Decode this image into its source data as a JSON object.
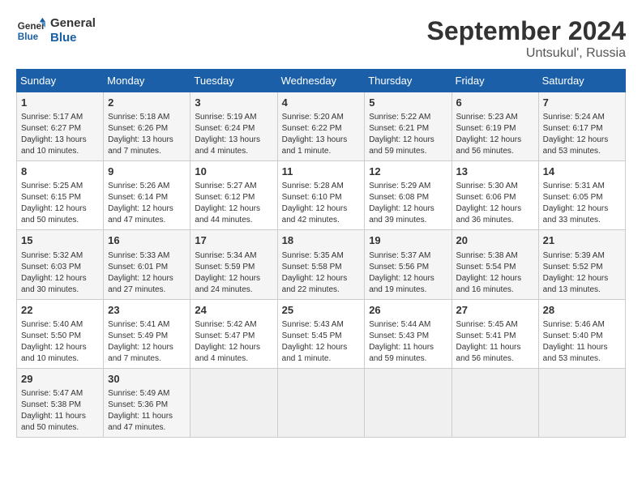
{
  "logo": {
    "line1": "General",
    "line2": "Blue"
  },
  "title": "September 2024",
  "subtitle": "Untsukul', Russia",
  "days_of_week": [
    "Sunday",
    "Monday",
    "Tuesday",
    "Wednesday",
    "Thursday",
    "Friday",
    "Saturday"
  ],
  "weeks": [
    [
      {
        "day": "1",
        "info": "Sunrise: 5:17 AM\nSunset: 6:27 PM\nDaylight: 13 hours and 10 minutes."
      },
      {
        "day": "2",
        "info": "Sunrise: 5:18 AM\nSunset: 6:26 PM\nDaylight: 13 hours and 7 minutes."
      },
      {
        "day": "3",
        "info": "Sunrise: 5:19 AM\nSunset: 6:24 PM\nDaylight: 13 hours and 4 minutes."
      },
      {
        "day": "4",
        "info": "Sunrise: 5:20 AM\nSunset: 6:22 PM\nDaylight: 13 hours and 1 minute."
      },
      {
        "day": "5",
        "info": "Sunrise: 5:22 AM\nSunset: 6:21 PM\nDaylight: 12 hours and 59 minutes."
      },
      {
        "day": "6",
        "info": "Sunrise: 5:23 AM\nSunset: 6:19 PM\nDaylight: 12 hours and 56 minutes."
      },
      {
        "day": "7",
        "info": "Sunrise: 5:24 AM\nSunset: 6:17 PM\nDaylight: 12 hours and 53 minutes."
      }
    ],
    [
      {
        "day": "8",
        "info": "Sunrise: 5:25 AM\nSunset: 6:15 PM\nDaylight: 12 hours and 50 minutes."
      },
      {
        "day": "9",
        "info": "Sunrise: 5:26 AM\nSunset: 6:14 PM\nDaylight: 12 hours and 47 minutes."
      },
      {
        "day": "10",
        "info": "Sunrise: 5:27 AM\nSunset: 6:12 PM\nDaylight: 12 hours and 44 minutes."
      },
      {
        "day": "11",
        "info": "Sunrise: 5:28 AM\nSunset: 6:10 PM\nDaylight: 12 hours and 42 minutes."
      },
      {
        "day": "12",
        "info": "Sunrise: 5:29 AM\nSunset: 6:08 PM\nDaylight: 12 hours and 39 minutes."
      },
      {
        "day": "13",
        "info": "Sunrise: 5:30 AM\nSunset: 6:06 PM\nDaylight: 12 hours and 36 minutes."
      },
      {
        "day": "14",
        "info": "Sunrise: 5:31 AM\nSunset: 6:05 PM\nDaylight: 12 hours and 33 minutes."
      }
    ],
    [
      {
        "day": "15",
        "info": "Sunrise: 5:32 AM\nSunset: 6:03 PM\nDaylight: 12 hours and 30 minutes."
      },
      {
        "day": "16",
        "info": "Sunrise: 5:33 AM\nSunset: 6:01 PM\nDaylight: 12 hours and 27 minutes."
      },
      {
        "day": "17",
        "info": "Sunrise: 5:34 AM\nSunset: 5:59 PM\nDaylight: 12 hours and 24 minutes."
      },
      {
        "day": "18",
        "info": "Sunrise: 5:35 AM\nSunset: 5:58 PM\nDaylight: 12 hours and 22 minutes."
      },
      {
        "day": "19",
        "info": "Sunrise: 5:37 AM\nSunset: 5:56 PM\nDaylight: 12 hours and 19 minutes."
      },
      {
        "day": "20",
        "info": "Sunrise: 5:38 AM\nSunset: 5:54 PM\nDaylight: 12 hours and 16 minutes."
      },
      {
        "day": "21",
        "info": "Sunrise: 5:39 AM\nSunset: 5:52 PM\nDaylight: 12 hours and 13 minutes."
      }
    ],
    [
      {
        "day": "22",
        "info": "Sunrise: 5:40 AM\nSunset: 5:50 PM\nDaylight: 12 hours and 10 minutes."
      },
      {
        "day": "23",
        "info": "Sunrise: 5:41 AM\nSunset: 5:49 PM\nDaylight: 12 hours and 7 minutes."
      },
      {
        "day": "24",
        "info": "Sunrise: 5:42 AM\nSunset: 5:47 PM\nDaylight: 12 hours and 4 minutes."
      },
      {
        "day": "25",
        "info": "Sunrise: 5:43 AM\nSunset: 5:45 PM\nDaylight: 12 hours and 1 minute."
      },
      {
        "day": "26",
        "info": "Sunrise: 5:44 AM\nSunset: 5:43 PM\nDaylight: 11 hours and 59 minutes."
      },
      {
        "day": "27",
        "info": "Sunrise: 5:45 AM\nSunset: 5:41 PM\nDaylight: 11 hours and 56 minutes."
      },
      {
        "day": "28",
        "info": "Sunrise: 5:46 AM\nSunset: 5:40 PM\nDaylight: 11 hours and 53 minutes."
      }
    ],
    [
      {
        "day": "29",
        "info": "Sunrise: 5:47 AM\nSunset: 5:38 PM\nDaylight: 11 hours and 50 minutes."
      },
      {
        "day": "30",
        "info": "Sunrise: 5:49 AM\nSunset: 5:36 PM\nDaylight: 11 hours and 47 minutes."
      },
      {
        "day": "",
        "info": ""
      },
      {
        "day": "",
        "info": ""
      },
      {
        "day": "",
        "info": ""
      },
      {
        "day": "",
        "info": ""
      },
      {
        "day": "",
        "info": ""
      }
    ]
  ]
}
